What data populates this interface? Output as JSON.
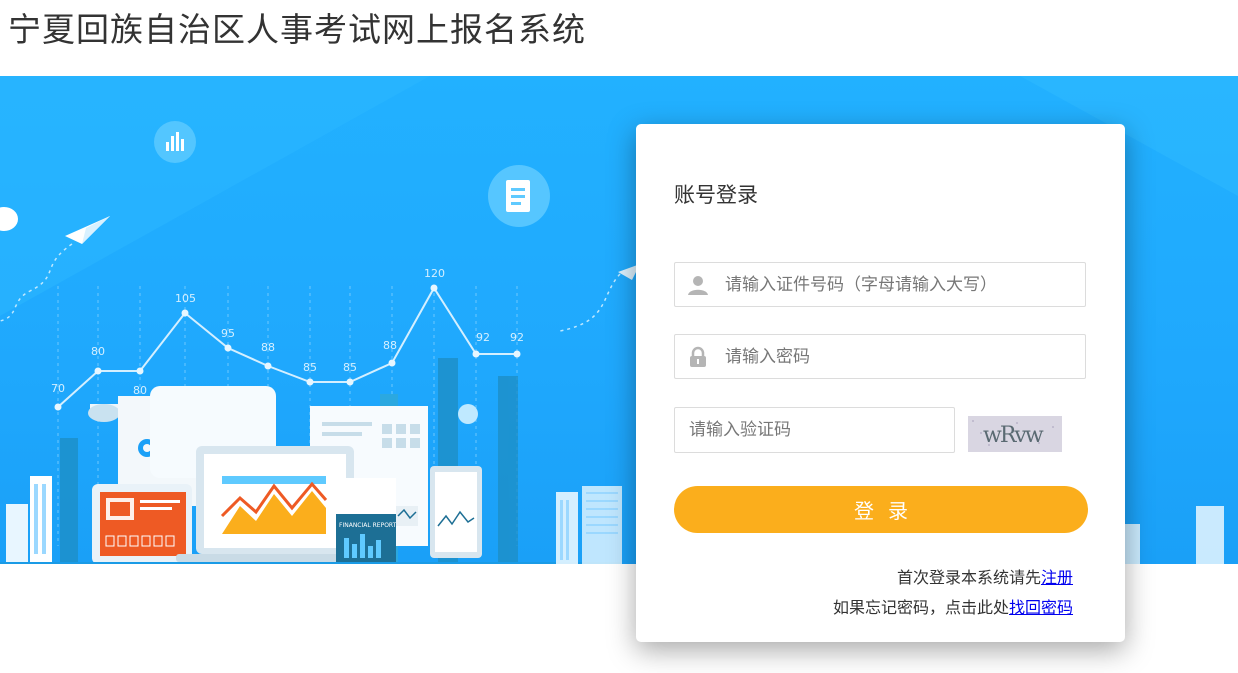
{
  "site": {
    "title": "宁夏回族自治区人事考试网上报名系统"
  },
  "banner": {
    "chart_points": [
      "70",
      "80",
      "80",
      "105",
      "95",
      "88",
      "85",
      "85",
      "88",
      "120",
      "92",
      "92"
    ],
    "report_label": "FINANCIAL REPORT"
  },
  "login": {
    "title": "账号登录",
    "id_placeholder": "请输入证件号码（字母请输入大写）",
    "password_placeholder": "请输入密码",
    "captcha_placeholder": "请输入验证码",
    "captcha_text": "wRvw",
    "submit_label": "登录",
    "register_prompt": "首次登录本系统请先",
    "register_link": "注册",
    "forgot_prompt": "如果忘记密码，点击此处",
    "forgot_link": "找回密码"
  },
  "colors": {
    "banner": "#22b1ff",
    "button": "#fbae1c",
    "link": "#0000ee"
  },
  "icons": [
    "user-icon",
    "lock-icon",
    "bar-chart-icon",
    "document-icon",
    "paper-plane-icon"
  ]
}
